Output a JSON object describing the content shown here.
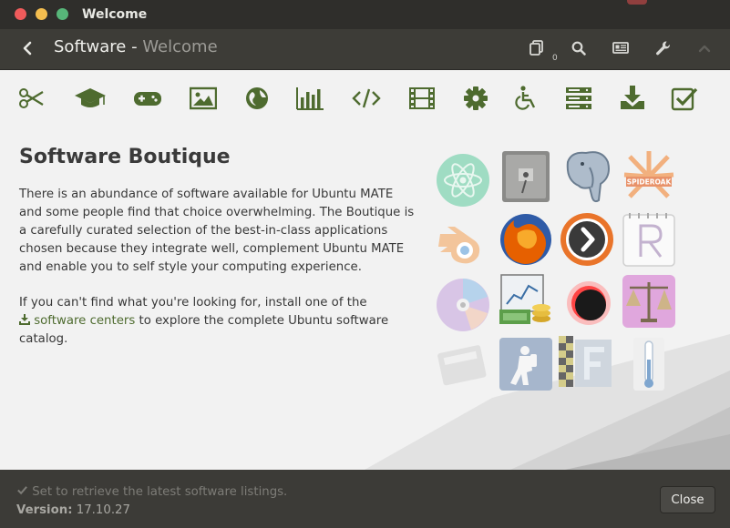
{
  "window": {
    "title": "Welcome"
  },
  "header": {
    "title": "Software",
    "separator": " - ",
    "subtitle": "Welcome",
    "queue_count": "0"
  },
  "toolbar": {
    "categories": [
      "accessories-icon",
      "education-icon",
      "games-icon",
      "graphics-icon",
      "internet-icon",
      "office-icon",
      "programming-icon",
      "sound-video-icon",
      "system-tools-icon",
      "universal-access-icon",
      "servers-icon",
      "install-icon",
      "installed-icon"
    ]
  },
  "main": {
    "heading": "Software Boutique",
    "paragraph1": "There is an abundance of software available for Ubuntu MATE and some people find that choice overwhelming. The Boutique is a carefully curated selection of the best-in-class applications chosen because they integrate well, complement Ubuntu MATE and enable you to self style your computing experience.",
    "paragraph2_before": "If you can't find what you're looking for, install one of the",
    "link_text": "software centers",
    "paragraph2_after": " to explore the complete Ubuntu software catalog."
  },
  "app_icons": {
    "spideroak_label": "SPIDEROAK"
  },
  "footer": {
    "status": "Set to retrieve the latest software listings.",
    "version_label": "Version:",
    "version_value": "17.10.27",
    "close_label": "Close"
  },
  "colors": {
    "accent": "#4e6b2f",
    "titlebar": "#2f2e2b",
    "header": "#3d3c37",
    "content_bg": "#f2f2f2"
  }
}
